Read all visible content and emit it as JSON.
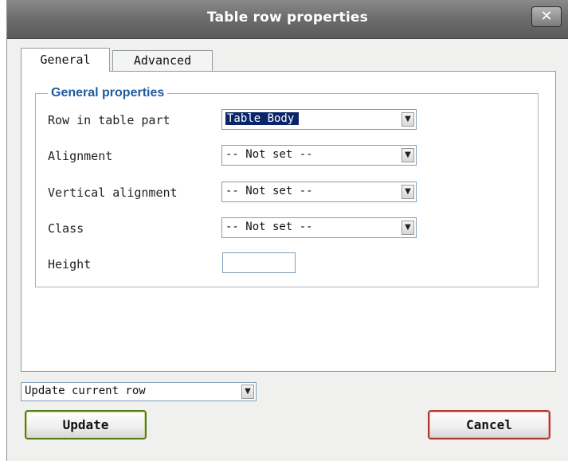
{
  "dialog": {
    "title": "Table row properties",
    "close_label": "✕"
  },
  "tabs": [
    {
      "label": "General",
      "active": true
    },
    {
      "label": "Advanced",
      "active": false
    }
  ],
  "general": {
    "legend": "General properties",
    "fields": {
      "row_part": {
        "label": "Row in table part",
        "value": "Table Body"
      },
      "alignment": {
        "label": "Alignment",
        "value": "-- Not set --"
      },
      "valign": {
        "label": "Vertical alignment",
        "value": "-- Not set --"
      },
      "class": {
        "label": "Class",
        "value": "-- Not set --"
      },
      "height": {
        "label": "Height",
        "value": ""
      }
    }
  },
  "footer": {
    "action_select": "Update current row",
    "update_label": "Update",
    "cancel_label": "Cancel"
  },
  "icons": {
    "dropdown": "chevron-down-icon",
    "close": "close-icon"
  },
  "colors": {
    "legend": "#1f5a9c",
    "selection": "#0a246a",
    "update_border": "#5a7a1a",
    "cancel_border": "#b03a2e"
  }
}
